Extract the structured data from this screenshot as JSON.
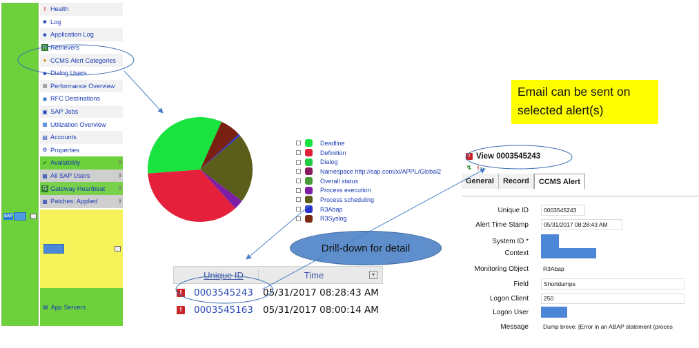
{
  "sidebar": {
    "items": [
      {
        "label": "Health",
        "icon": "exclamation-icon"
      },
      {
        "label": "Log",
        "icon": "users-icon"
      },
      {
        "label": "Application Log",
        "icon": "users-icon"
      },
      {
        "label": "Retrievers",
        "icon": "retriever-icon"
      },
      {
        "label": "CCMS Alert Categories",
        "icon": "alert-category-icon"
      },
      {
        "label": "Dialog Users",
        "icon": "dialog-users-icon"
      },
      {
        "label": "Performance Overview",
        "icon": "performance-icon"
      },
      {
        "label": "RFC Destinations",
        "icon": "rfc-icon"
      },
      {
        "label": "SAP Jobs",
        "icon": "jobs-icon"
      },
      {
        "label": "Utilization Overview",
        "icon": "utilization-icon"
      },
      {
        "label": "Accounts",
        "icon": "accounts-icon"
      },
      {
        "label": "Properties",
        "icon": "properties-icon"
      },
      {
        "label": "Availability",
        "icon": "check-icon"
      },
      {
        "label": "All SAP Users",
        "icon": "users-table-icon"
      },
      {
        "label": "Gateway Heartbeat",
        "icon": "gateway-icon"
      },
      {
        "label": "Patches: Applied",
        "icon": "patch-icon"
      }
    ],
    "app_servers": "App Servers"
  },
  "legend": [
    {
      "label": "Deadline",
      "color": "#19e33f"
    },
    {
      "label": "Definition",
      "color": "#e0203a"
    },
    {
      "label": "Dialog",
      "color": "#22cc44"
    },
    {
      "label": "Namespace http://sap.com/xi/APPL/Global2",
      "color": "#8a1a5e"
    },
    {
      "label": "Overall status",
      "color": "#4a9a3a"
    },
    {
      "label": "Process execution",
      "color": "#7d1fa6"
    },
    {
      "label": "Process scheduling",
      "color": "#5b5e1a"
    },
    {
      "label": "R3Abap",
      "color": "#2a33c9"
    },
    {
      "label": "R3Syslog",
      "color": "#7a2a12"
    }
  ],
  "pie": {
    "slices": [
      {
        "name": "R3Syslog",
        "value": 6.5,
        "color": "#7a2012"
      },
      {
        "name": "R3Abap",
        "value": 0.6,
        "color": "#2a33c9"
      },
      {
        "name": "Process scheduling",
        "value": 21.5,
        "color": "#5b5e1a"
      },
      {
        "name": "Process execution",
        "value": 3.0,
        "color": "#7d1fa6"
      },
      {
        "name": "Definition",
        "value": 35.5,
        "color": "#e4203a"
      },
      {
        "name": "Deadline",
        "value": 32.9,
        "color": "#19e33f"
      }
    ]
  },
  "grid": {
    "headers": [
      "Unique ID",
      "Time"
    ],
    "rows": [
      {
        "id": "0003545243",
        "time": "05/31/2017 08:28:43 AM"
      },
      {
        "id": "0003545163",
        "time": "05/31/2017 08:00:14 AM"
      }
    ],
    "filter_icon": "▾"
  },
  "detail": {
    "title": "View 0003545243",
    "tabs": [
      "General",
      "Record",
      "CCMS Alert"
    ],
    "fields": [
      {
        "label": "Unique ID",
        "value": "0003545243"
      },
      {
        "label": "Alert Time Stamp",
        "value": "05/31/2017 08:28:43 AM"
      },
      {
        "label": "System ID *",
        "value": ""
      },
      {
        "label": "Context",
        "value": ""
      },
      {
        "label": "Monitoring Object",
        "value": "R3Abap"
      },
      {
        "label": "Field",
        "value": "Shortdumps"
      },
      {
        "label": "Logon Client",
        "value": "250"
      },
      {
        "label": "Logon User",
        "value": ""
      },
      {
        "label": "Message",
        "value": "Dump breve: [Error in an ABAP statement (proces"
      }
    ]
  },
  "annotations": {
    "email_note": "Email can be sent on selected alert(s)",
    "drilldown": "Drill-down for detail"
  }
}
